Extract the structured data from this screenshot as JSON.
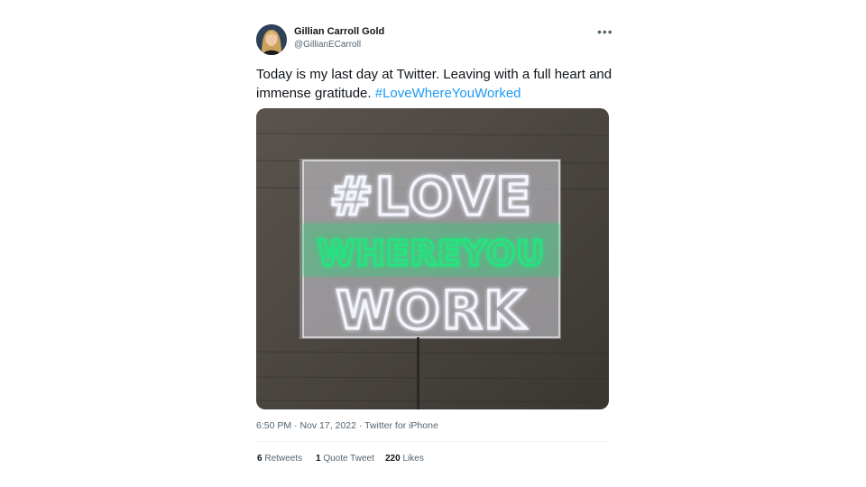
{
  "author": {
    "name": "Gillian Carroll Gold",
    "handle": "@GillianECarroll"
  },
  "tweet": {
    "text": "Today is my last day at Twitter. Leaving with a full heart and immense gratitude. ",
    "hashtag": "#LoveWhereYouWorked"
  },
  "photo": {
    "line1": "#LOVE",
    "line2": "WHEREYOU",
    "line3": "WORK",
    "neon_white": "#f4f6ff",
    "neon_green": "#25e27f"
  },
  "meta": {
    "time": "6:50 PM",
    "separator1": " · ",
    "date": "Nov 17, 2022",
    "separator2": " · ",
    "source": "Twitter for iPhone"
  },
  "stats": {
    "retweets_count": "6",
    "retweets_label": "Retweets",
    "quotes_count": "1",
    "quotes_label": "Quote Tweet",
    "likes_count": "220",
    "likes_label": "Likes"
  },
  "icons": {
    "more": "more-icon"
  }
}
